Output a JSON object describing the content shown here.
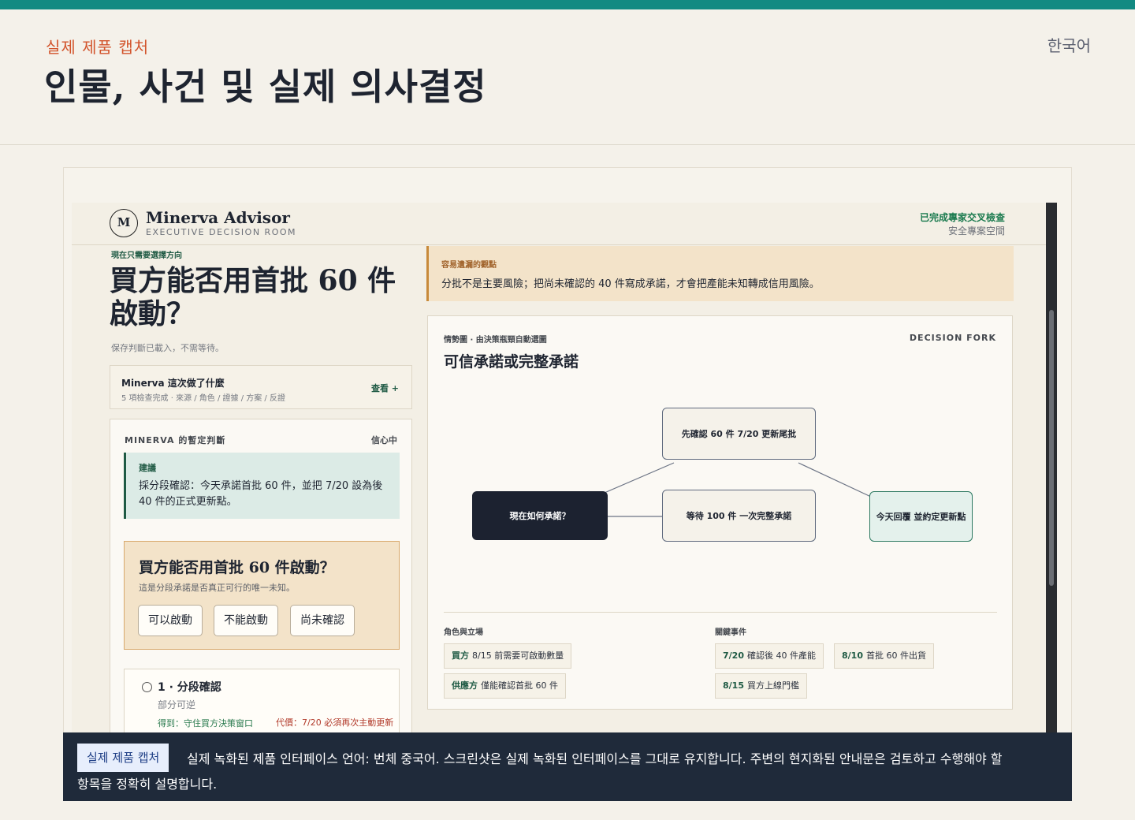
{
  "page": {
    "eyebrow": "실제 제품 캡처",
    "title": "인물, 사건 및 실제 의사결정",
    "language": "한국어"
  },
  "app": {
    "logo_letter": "M",
    "brand": "Minerva Advisor",
    "brand_sub": "EXECUTIVE DECISION ROOM",
    "status": "已完成專家交叉檢查",
    "status_sub": "安全專案空間"
  },
  "left": {
    "eyebrow": "現在只需要選擇方向",
    "question": "買方能否用首批 60 件啟動？",
    "loaded": "保存判斷已載入，不需等待。",
    "did": {
      "title": "Minerva 這次做了什麼",
      "sub": "5 項檢查完成 · 來源 / 角色 / 證據 / 方案 / 反證",
      "view": "查看 +"
    },
    "judgement": {
      "title": "MINERVA 的暫定判斷",
      "confidence": "信心中",
      "advice_label": "建議",
      "advice_text": "採分段確認：今天承諾首批 60 件，並把 7/20 設為後 40 件的正式更新點。"
    },
    "unknown": {
      "question": "買方能否用首批 60 件啟動？",
      "sub": "這是分段承諾是否真正可行的唯一未知。",
      "options": [
        "可以啟動",
        "不能啟動",
        "尚未確認"
      ]
    },
    "option1": {
      "title": "1 · 分段確認",
      "sub": "部分可逆",
      "gain": "得到：守住買方決策窗口",
      "cost": "代價：7/20 必須再次主動更新"
    }
  },
  "risk": {
    "label": "容易遺漏的觀點",
    "text": "分批不是主要風險；把尚未確認的 40 件寫成承諾，才會把產能未知轉成信用風險。"
  },
  "situation": {
    "eyebrow": "情勢圖 · 由決策瓶頸自動選圖",
    "tag": "DECISION FORK",
    "title": "可信承諾或完整承諾",
    "nodes": {
      "root": "現在如何承諾？",
      "top": "先確認 60 件 7/20 更新尾批",
      "middle": "等待 100 件 一次完整承諾",
      "right": "今天回覆 並約定更新點"
    },
    "roles_header": "角色與立場",
    "events_header": "關鍵事件",
    "roles": [
      {
        "who": "買方",
        "what": "8/15 前需要可啟動數量"
      },
      {
        "who": "供應方",
        "what": "僅能確認首批 60 件"
      }
    ],
    "events": [
      {
        "date": "7/20",
        "what": "確認後 40 件產能"
      },
      {
        "date": "8/10",
        "what": "首批 60 件出貨"
      },
      {
        "date": "8/15",
        "what": "買方上線門檻"
      }
    ]
  },
  "caption": {
    "badge": "실제 제품 캡처",
    "line1": "실제 녹화된 제품 인터페이스 언어: 번체 중국어. 스크린샷은 실제 녹화된 인터페이스를 그대로 유지합니다. 주변의 현지화된 안내문은 검토하고 수행해야 할",
    "line2": "항목을 정확히 설명합니다."
  },
  "colors": {
    "brand_teal": "#128a82",
    "accent_orange": "#d2542c",
    "dark_navy": "#1c2230",
    "advice_green": "#1f5a44",
    "caption_bg": "#1f2a3a"
  },
  "icons": [
    "radio-icon",
    "logo-mark"
  ]
}
